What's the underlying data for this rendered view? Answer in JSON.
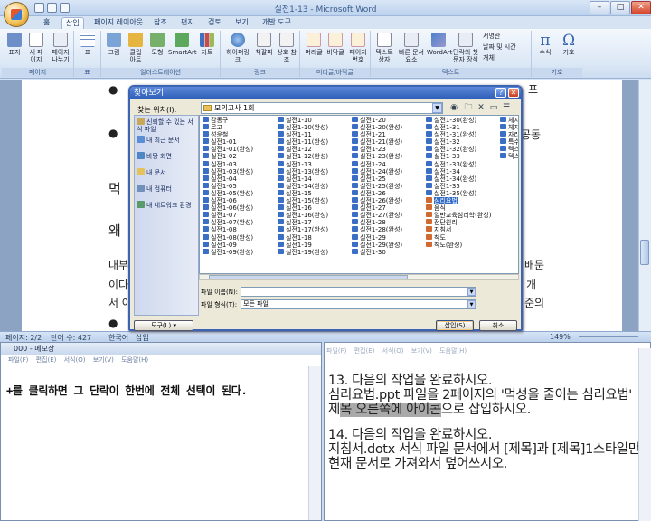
{
  "word": {
    "title": "실전1-13 - Microsoft Word",
    "tabs": [
      {
        "label": "홈"
      },
      {
        "label": "삽입"
      },
      {
        "label": "페이지 레이아웃"
      },
      {
        "label": "참조"
      },
      {
        "label": "편지"
      },
      {
        "label": "검토"
      },
      {
        "label": "보기"
      },
      {
        "label": "개발 도구"
      }
    ],
    "active_tab": "삽입",
    "groups": [
      "페이지",
      "표",
      "일러스트레이션",
      "링크",
      "머리글/바닥글",
      "텍스트",
      "기호"
    ],
    "ribbon_items": {
      "cover": "표지",
      "blank": "새 페이지",
      "break": "페이지 나누기",
      "table": "표",
      "picture": "그림",
      "clipart": "클립 아트",
      "shapes": "도형",
      "smartart": "SmartArt",
      "chart": "차트",
      "hyperlink": "하이퍼링크",
      "bookmark": "책갈피",
      "crossref": "상호 참조",
      "header": "머리글",
      "footer": "바닥글",
      "pagenum": "페이지 번호",
      "textbox": "텍스트 상자",
      "quickparts": "빠른 문서 요소",
      "wordart": "WordArt",
      "dropcap": "단락의 첫 문자 장식",
      "signature": "서명란",
      "datetime": "날짜 및 시간",
      "object": "개체",
      "equation": "수식",
      "symbol": "기호"
    },
    "doc_fragments": {
      "a": "포",
      "b": "공동",
      "c": "먹",
      "d": "왜",
      "e": "대부",
      "f": "이다",
      "g": "서 아",
      "h": "배문",
      "i": "개",
      "j": "준의",
      "bullet": "●"
    },
    "status": {
      "page": "페이지: 2/2",
      "words": "단어 수: 427",
      "lang": "한국어",
      "insert": "삽입",
      "zoom": "149%"
    }
  },
  "dialog": {
    "title": "찾아보기",
    "lookin_label": "찾는 위치(I):",
    "lookin_value": "모의고사 1회",
    "places": [
      "신뢰할 수 있는 서식 파일",
      "내 최근 문서",
      "바탕 화면",
      "내 문서",
      "내 컴퓨터",
      "내 네트워크 환경"
    ],
    "col1": [
      "감동구",
      "로고",
      "성윤철",
      "실전1-01",
      "실전1-01(완성)",
      "실전1-02",
      "실전1-03",
      "실전1-03(완성)",
      "실전1-04",
      "실전1-05",
      "실전1-05(완성)",
      "실전1-06",
      "실전1-06(완성)",
      "실전1-07",
      "실전1-07(완성)",
      "실전1-08",
      "실전1-08(완성)",
      "실전1-09",
      "실전1-09(완성)"
    ],
    "col2": [
      "실전1-10",
      "실전1-10(완성)",
      "실전1-11",
      "실전1-11(완성)",
      "실전1-12",
      "실전1-12(완성)",
      "실전1-13",
      "실전1-13(완성)",
      "실전1-14",
      "실전1-14(완성)",
      "실전1-15",
      "실전1-15(완성)",
      "실전1-16",
      "실전1-16(완성)",
      "실전1-17",
      "실전1-17(완성)",
      "실전1-18",
      "실전1-19",
      "실전1-19(완성)"
    ],
    "col3": [
      "실전1-20",
      "실전1-20(완성)",
      "실전1-21",
      "실전1-21(완성)",
      "실전1-23",
      "실전1-23(완성)",
      "실전1-24",
      "실전1-24(완성)",
      "실전1-25",
      "실전1-25(완성)",
      "실전1-26",
      "실전1-26(완성)",
      "실전1-27",
      "실전1-27(완성)",
      "실전1-28",
      "실전1-28(완성)",
      "실전1-29",
      "실전1-29(완성)",
      "실전1-30"
    ],
    "col4": [
      "실전1-30(완성)",
      "실전1-31",
      "실전1-31(완성)",
      "실전1-32",
      "실전1-32(완성)",
      "실전1-33",
      "실전1-33(완성)",
      "실전1-34",
      "실전1-34(완성)",
      "실전1-35",
      "실전1-35(완성)",
      "심리요법",
      "음식",
      "일반교육심리학(완성)",
      "전단원리",
      "지침서",
      "착도",
      "착도(완성)"
    ],
    "col5": [
      "체지",
      "체지",
      "자라",
      "특수",
      "텍스",
      "텍스"
    ],
    "selected": "심리요법",
    "filename_label": "파일 이름(N):",
    "filename_value": "",
    "filetype_label": "파일 형식(T):",
    "filetype_value": "모든 파일",
    "tools_label": "도구(L)",
    "open_label": "삽입(S)",
    "cancel_label": "취소"
  },
  "notepad": {
    "title": "000 - 메모장",
    "menu": [
      "파일(F)",
      "편집(E)",
      "서식(O)",
      "보기(V)",
      "도움말(H)"
    ],
    "text": "+를 클릭하면 그 단락이 한번에 전체 선택이 된다."
  },
  "instructions": {
    "menu": [
      "파일(F)",
      "편집(E)",
      "서식(O)",
      "보기(V)",
      "도움말(H)"
    ],
    "q13_title": "13. 다음의 작업을 완료하시오.",
    "q13_body_pre": "    심리요법.ppt 파일을 2페이지의  '먹성을 줄이는 심리요법'  제",
    "q13_body_hl": "목 오른쪽에 아이콘",
    "q13_body_post": "으로 삽입하시오.",
    "q14_title": "14. 다음의 작업을 완료하시오.",
    "q14_body": "    지침서.dotx 서식 파일 문서에서 [제목]과 [제목]1스타일만 현재 문서로 가져와서 덮어쓰시오."
  },
  "colors": {
    "accent": "#2c5cb6",
    "highlight": "#a9a9a9",
    "ribbon": "#dce8f6"
  }
}
